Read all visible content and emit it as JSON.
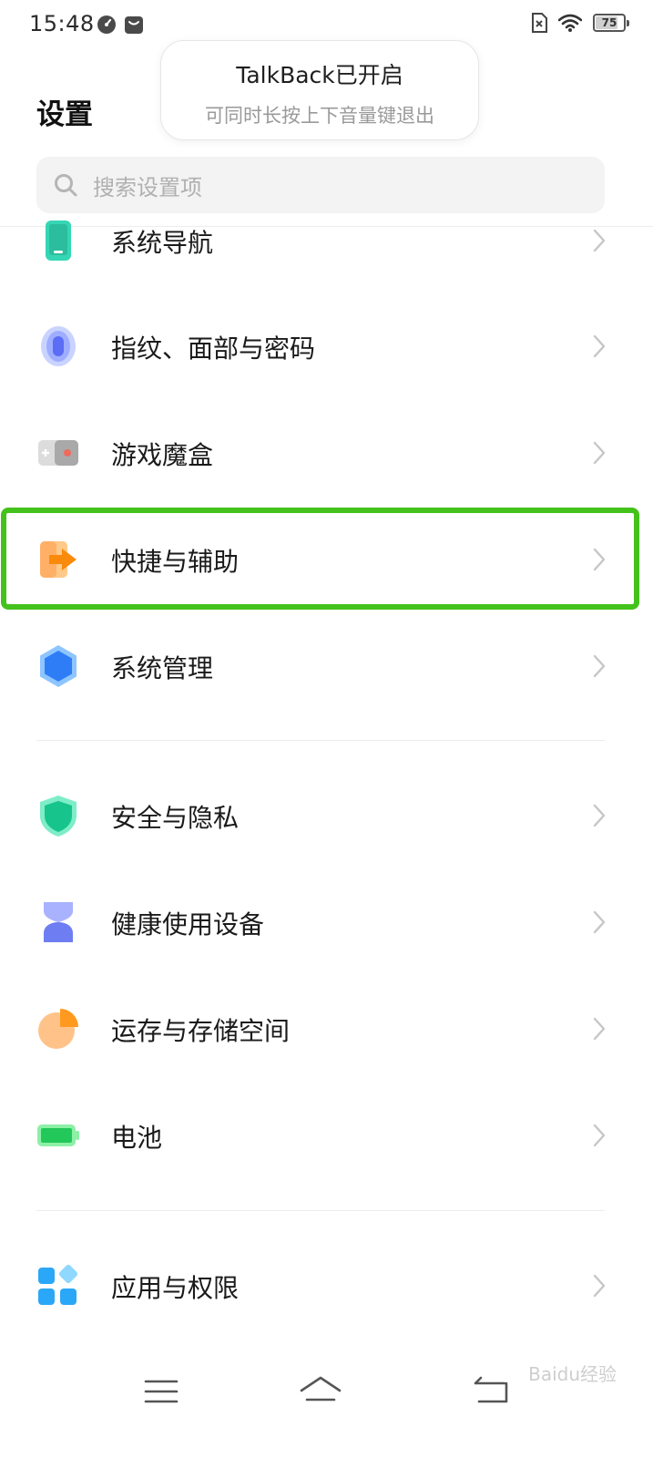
{
  "status_bar": {
    "time": "15:48",
    "battery": "75"
  },
  "toast": {
    "title": "TalkBack已开启",
    "subtitle": "可同时长按上下音量键退出"
  },
  "header": {
    "title": "设置",
    "search_placeholder": "搜索设置项"
  },
  "items": [
    {
      "label": "系统导航",
      "icon": "navigation-phone-icon"
    },
    {
      "label": "指纹、面部与密码",
      "icon": "fingerprint-icon"
    },
    {
      "label": "游戏魔盒",
      "icon": "game-box-icon"
    },
    {
      "label": "快捷与辅助",
      "icon": "shortcut-arrow-icon",
      "highlighted": true
    },
    {
      "label": "系统管理",
      "icon": "system-hexagon-icon"
    },
    {
      "label": "安全与隐私",
      "icon": "shield-icon"
    },
    {
      "label": "健康使用设备",
      "icon": "hourglass-icon"
    },
    {
      "label": "运存与存储空间",
      "icon": "pie-storage-icon"
    },
    {
      "label": "电池",
      "icon": "battery-icon"
    },
    {
      "label": "应用与权限",
      "icon": "apps-grid-icon"
    }
  ],
  "watermark": "Baidu经验",
  "colors": {
    "highlight": "#44c21c",
    "accent_blue": "#2f7df6"
  }
}
